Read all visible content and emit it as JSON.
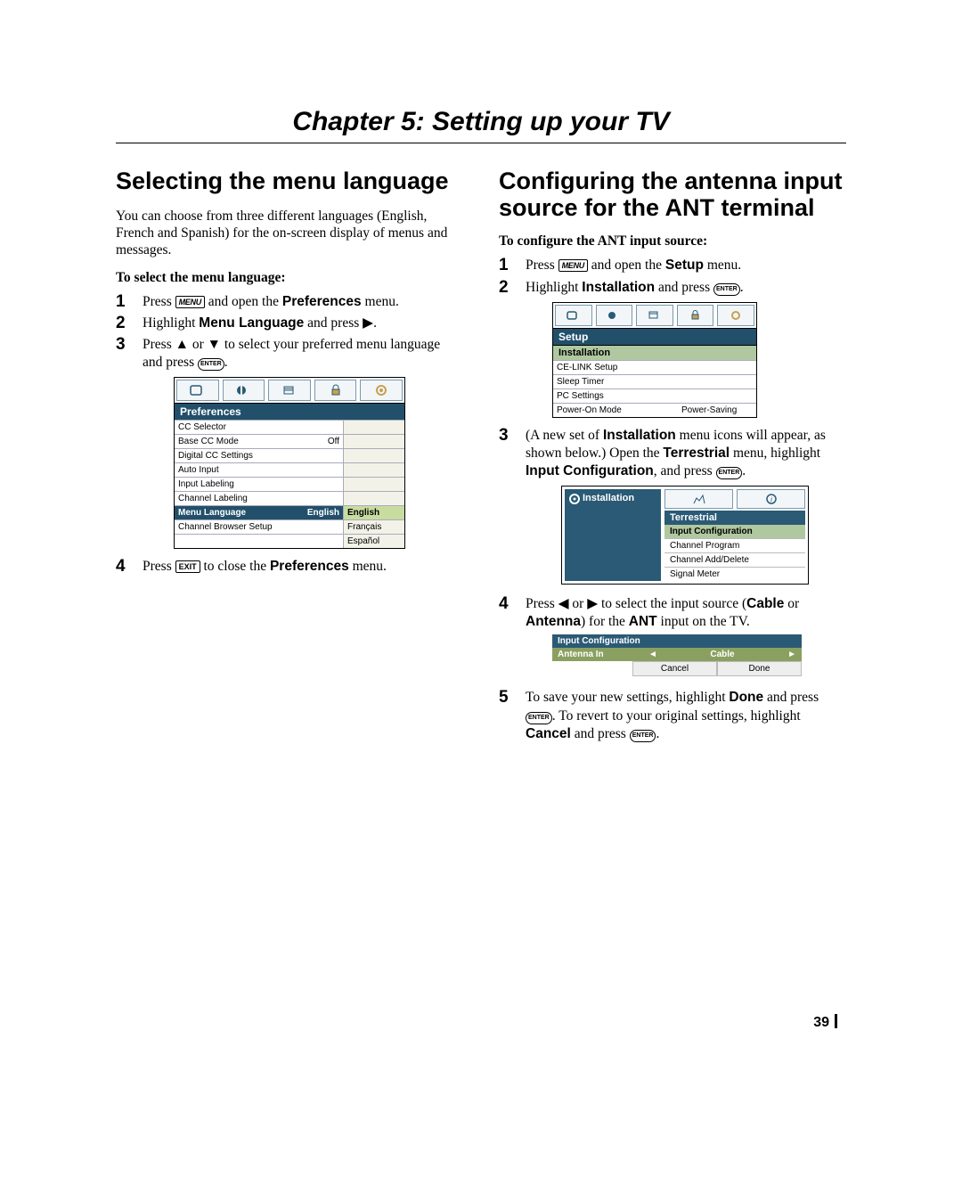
{
  "chapter_title": "Chapter 5: Setting up your TV",
  "left": {
    "heading": "Selecting the menu language",
    "intro": "You can choose from three different languages (English, French and Spanish) for the on-screen display of menus and messages.",
    "subhead": "To select the menu language:",
    "steps": {
      "s1a": "Press ",
      "s1_key": "MENU",
      "s1b": " and open the ",
      "s1_bold": "Preferences",
      "s1c": " menu.",
      "s2a": "Highlight ",
      "s2_bold": "Menu Language",
      "s2b": " and press ",
      "s2_arrow": "▶",
      "s2c": ".",
      "s3a": "Press ",
      "s3_up": "▲",
      "s3b": " or ",
      "s3_down": "▼",
      "s3c": " to select your preferred menu language and press ",
      "s3_key": "ENTER",
      "s3d": ".",
      "s4a": "Press ",
      "s4_key": "EXIT",
      "s4b": " to close the ",
      "s4_bold": "Preferences",
      "s4c": " menu."
    },
    "menu": {
      "title": "Preferences",
      "rows": [
        {
          "l": "CC Selector",
          "m": "",
          "r": ""
        },
        {
          "l": "Base CC Mode",
          "m": "Off",
          "r": ""
        },
        {
          "l": "Digital CC Settings",
          "m": "",
          "r": ""
        },
        {
          "l": "Auto Input",
          "m": "",
          "r": ""
        },
        {
          "l": "Input Labeling",
          "m": "",
          "r": ""
        },
        {
          "l": "Channel Labeling",
          "m": "",
          "r": ""
        },
        {
          "l": "Menu Language",
          "m": "English",
          "r": "English",
          "sel": true
        },
        {
          "l": "Channel Browser Setup",
          "m": "",
          "r": "Français"
        },
        {
          "l": "",
          "m": "",
          "r": "Español"
        }
      ]
    }
  },
  "right": {
    "heading": "Configuring the antenna input source for the ANT terminal",
    "subhead": "To configure the ANT input source:",
    "steps": {
      "s1a": "Press ",
      "s1_key": "MENU",
      "s1b": " and open the ",
      "s1_bold": "Setup",
      "s1c": " menu.",
      "s2a": "Highlight ",
      "s2_bold": "Installation",
      "s2b": " and press ",
      "s2_key": "ENTER",
      "s2c": ".",
      "s3a": "(A new set of ",
      "s3_bold1": "Installation",
      "s3b": " menu icons will appear, as shown below.) Open the ",
      "s3_bold2": "Terrestrial",
      "s3c": " menu, highlight ",
      "s3_bold3": "Input Configuration",
      "s3d": ", and press ",
      "s3_key": "ENTER",
      "s3e": ".",
      "s4a": "Press ",
      "s4_l": "◀",
      "s4b": " or ",
      "s4_r": "▶",
      "s4c": " to select the input source (",
      "s4_bold1": "Cable",
      "s4d": " or ",
      "s4_bold2": "Antenna",
      "s4e": ") for the ",
      "s4_bold3": "ANT",
      "s4f": " input on the TV.",
      "s5a": "To save your new settings, highlight ",
      "s5_bold1": "Done",
      "s5b": " and press ",
      "s5_key": "ENTER",
      "s5c": ". To revert to your original settings, highlight ",
      "s5_bold2": "Cancel",
      "s5d": " and press ",
      "s5_key2": "ENTER",
      "s5e": "."
    },
    "setup_menu": {
      "title": "Setup",
      "sel": "Installation",
      "rows": [
        {
          "l": "CE-LINK Setup",
          "m": ""
        },
        {
          "l": "Sleep Timer",
          "m": ""
        },
        {
          "l": "PC Settings",
          "m": ""
        },
        {
          "l": "Power-On Mode",
          "m": "Power-Saving"
        }
      ]
    },
    "install_menu": {
      "left_label": "Installation",
      "header": "Terrestrial",
      "sel": "Input Configuration",
      "items": [
        "Channel Program",
        "Channel Add/Delete",
        "Signal Meter"
      ]
    },
    "inputcfg": {
      "title": "Input Configuration",
      "label": "Antenna In",
      "value": "Cable",
      "left_arrow": "◄",
      "right_arrow": "►",
      "cancel": "Cancel",
      "done": "Done"
    }
  },
  "page_number": "39"
}
